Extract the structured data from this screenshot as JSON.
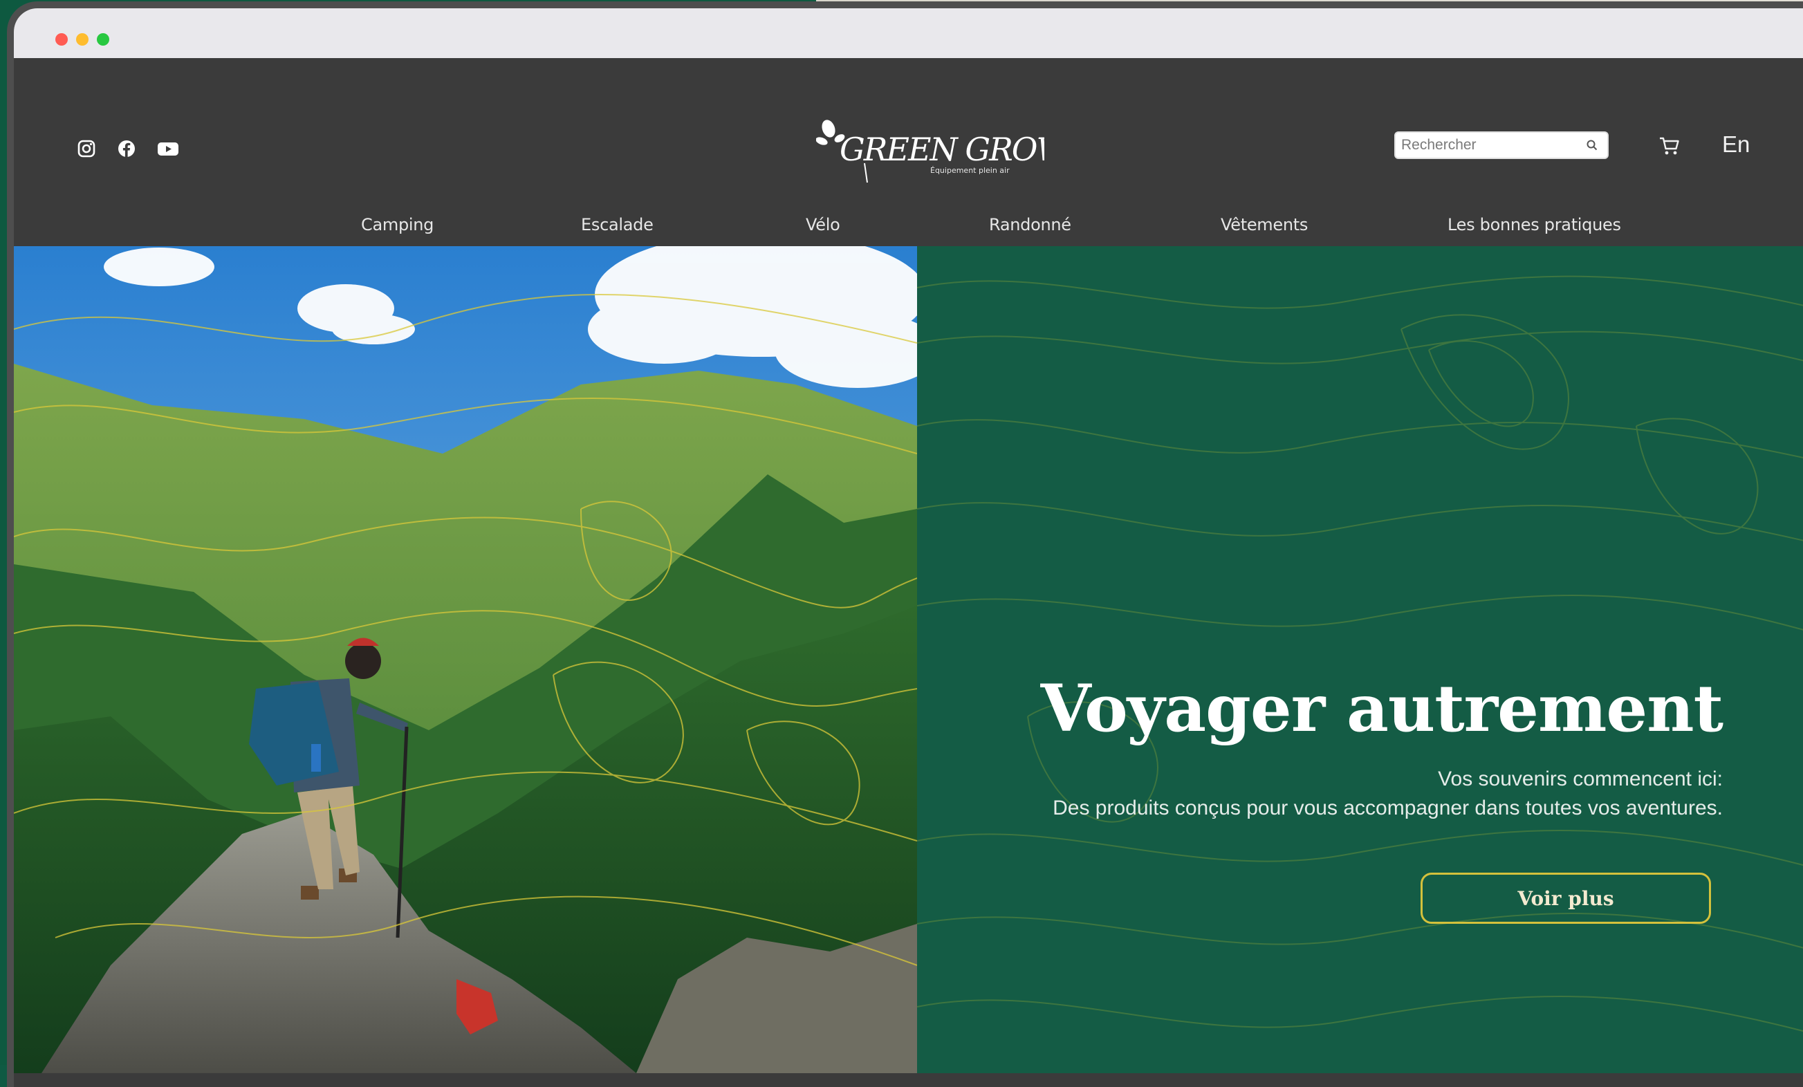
{
  "brand": {
    "logo_text": "GREEN GROW",
    "tagline": "Équipement plein air"
  },
  "header": {
    "social_icons": [
      "instagram-icon",
      "facebook-icon",
      "youtube-icon"
    ],
    "search": {
      "placeholder": "Rechercher"
    },
    "cart_icon": "cart-icon",
    "language": "En"
  },
  "nav": {
    "items": [
      {
        "label": "Camping"
      },
      {
        "label": "Escalade"
      },
      {
        "label": "Vélo"
      },
      {
        "label": "Randonné"
      },
      {
        "label": "Vêtements"
      },
      {
        "label": "Les bonnes pratiques"
      }
    ]
  },
  "hero": {
    "title": "Voyager autrement",
    "subtitle_line1": "Vos souvenirs commencent ici:",
    "subtitle_line2": "Des produits conçus pour vous accompagner dans toutes vos aventures.",
    "cta_label": "Voir plus"
  },
  "colors": {
    "header_bg": "#3b3b3b",
    "hero_green": "#145c45",
    "accent_gold": "#d4c13c"
  }
}
